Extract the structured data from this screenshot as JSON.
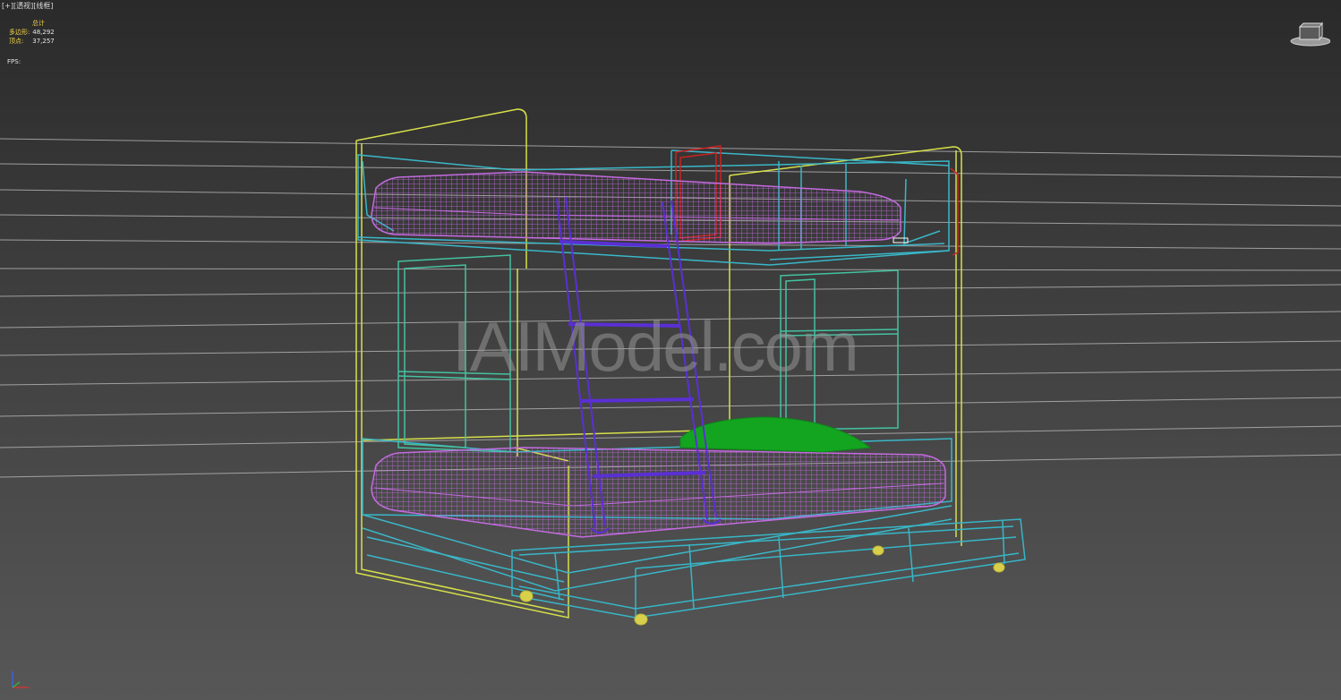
{
  "viewport": {
    "label_plus": "[+]",
    "label_view": "[透视]",
    "label_shading": "[线框]"
  },
  "stats": {
    "title": "总计",
    "polygons_label": "多边形:",
    "polygons_value": "48,292",
    "vertices_label": "顶点:",
    "vertices_value": "37,257",
    "fps_label": "FPS:",
    "fps_value": ""
  },
  "watermark": "IAIModel.com",
  "icons": {
    "viewcube": "viewcube-icon",
    "axis": "axis-gizmo-icon"
  },
  "colors": {
    "frame_yellow": "#d7e04a",
    "frame_cyan": "#3ab7c8",
    "mattress_pink": "#c46be0",
    "ladder_purple": "#5a2fd4",
    "pillow_green": "#13a520",
    "drawer_cyan": "#37b6c7",
    "shelf_green": "#44c2a0",
    "red_accent": "#cc2222",
    "wheel_yellow": "#d8d04a"
  }
}
